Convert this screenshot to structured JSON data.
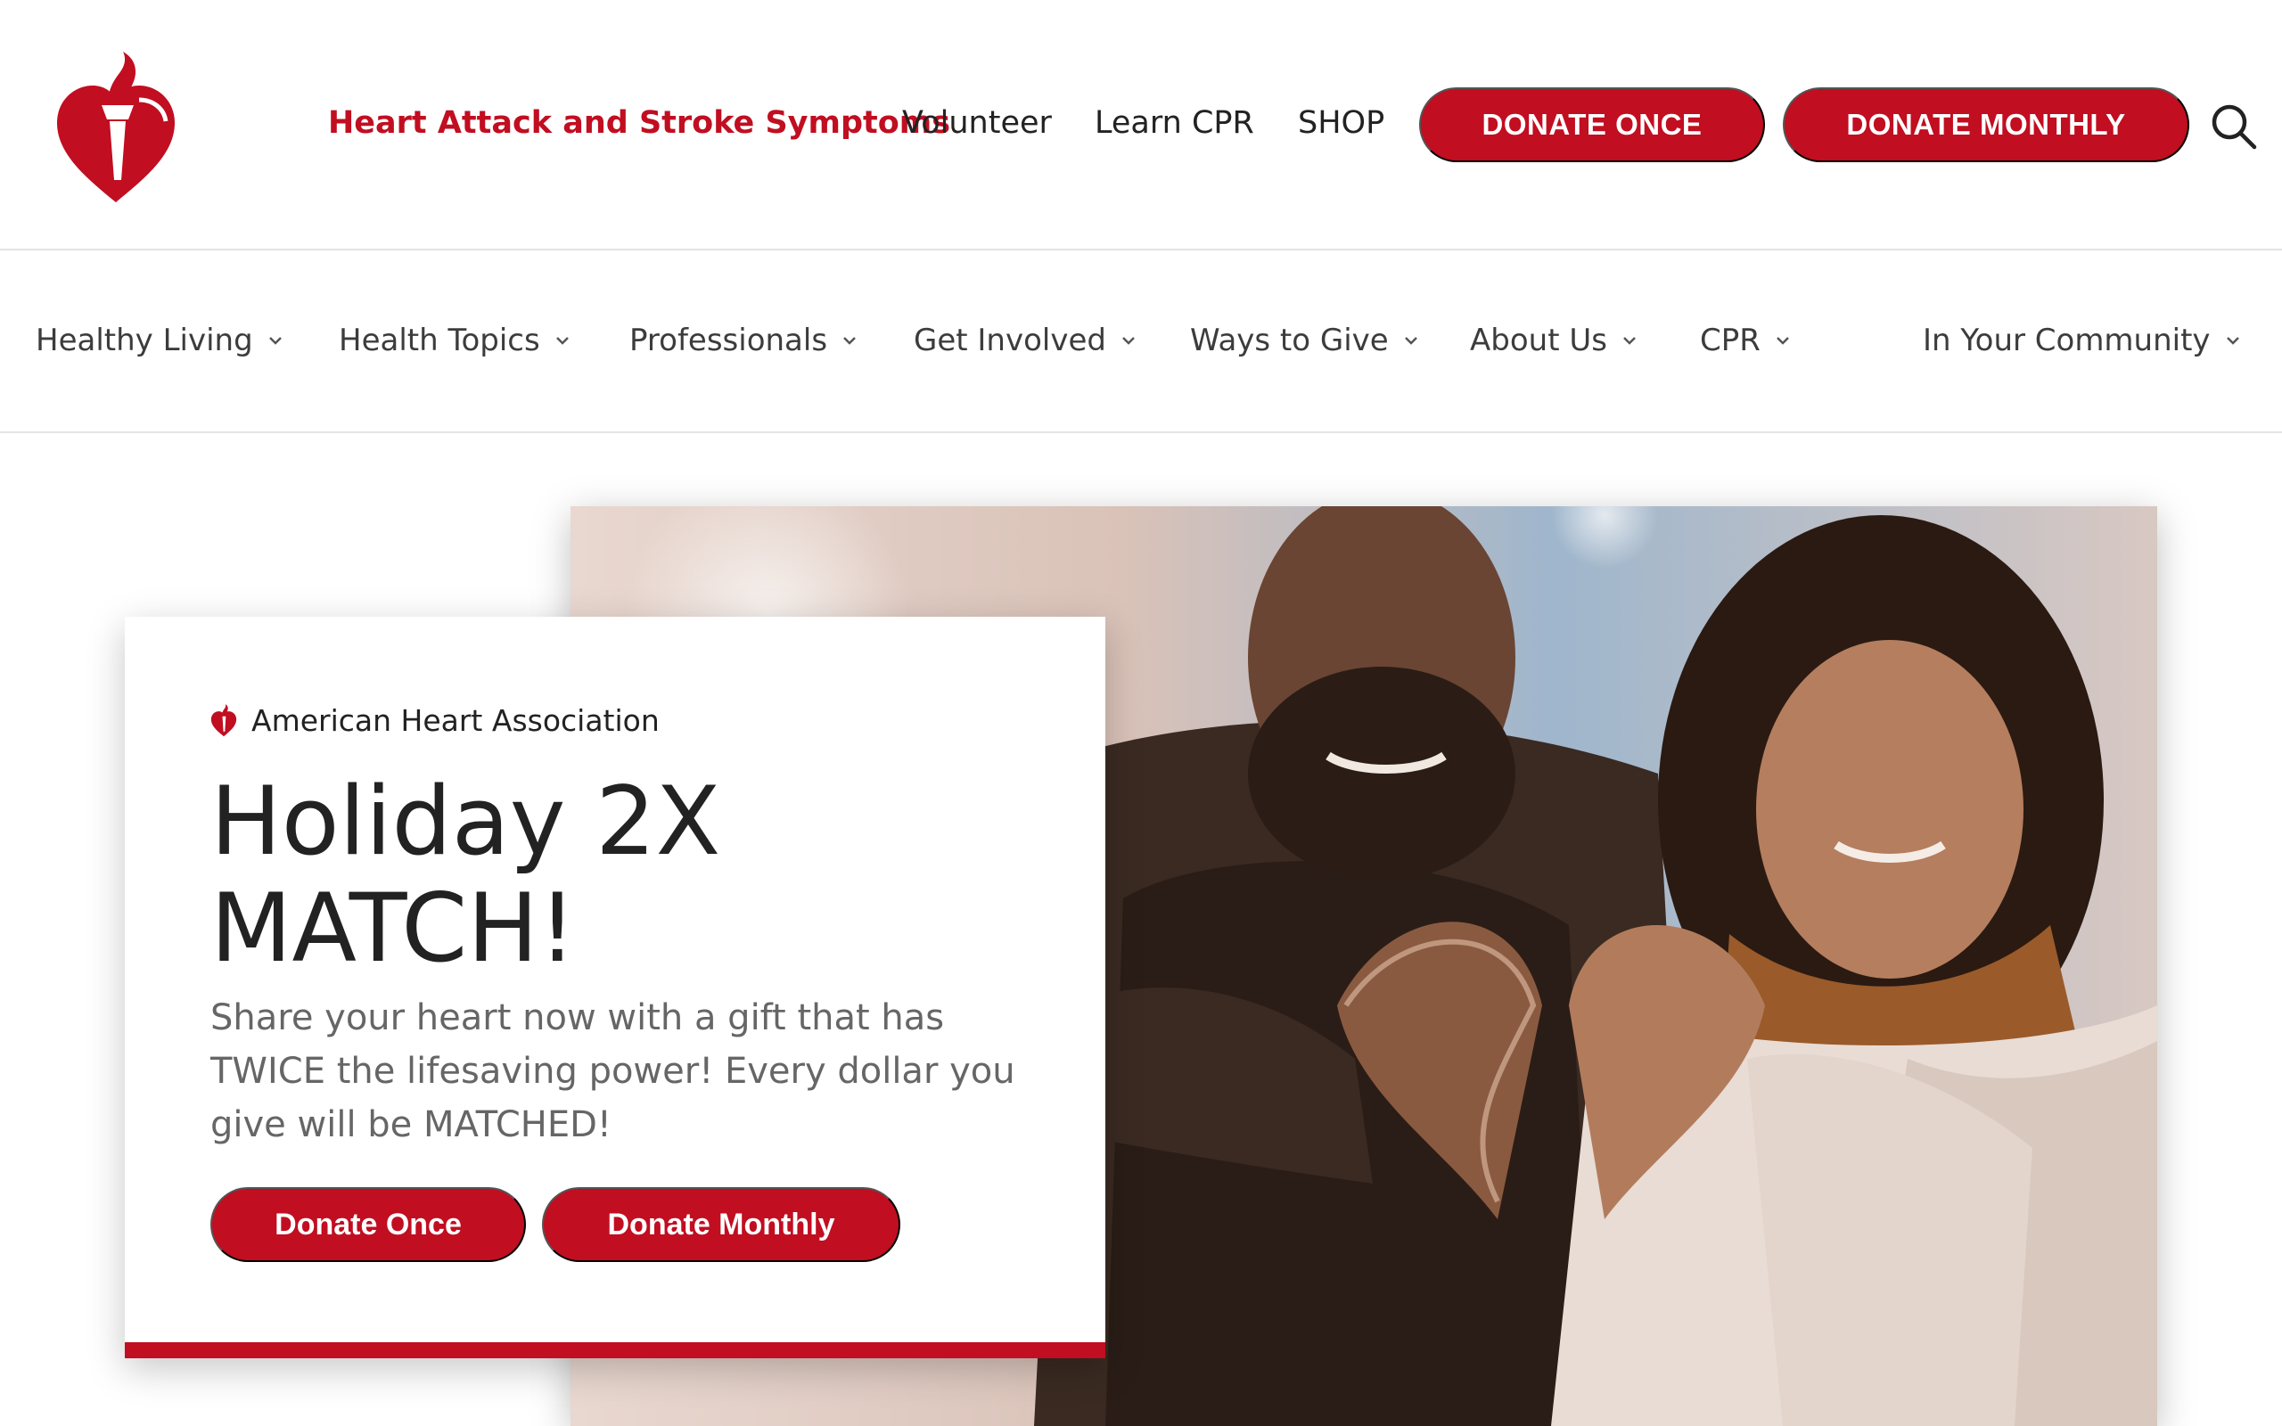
{
  "header": {
    "logo_icon": "aha-heart-torch-logo",
    "links": [
      {
        "label": "Heart Attack and Stroke Symptoms",
        "highlight": true
      },
      {
        "label": "Volunteer"
      },
      {
        "label": "Learn CPR"
      },
      {
        "label": "SHOP"
      }
    ],
    "donate_once": "DONATE ONCE",
    "donate_monthly": "DONATE MONTHLY",
    "search_icon": "search-icon"
  },
  "nav": {
    "items": [
      {
        "label": "Healthy Living"
      },
      {
        "label": "Health Topics"
      },
      {
        "label": "Professionals"
      },
      {
        "label": "Get Involved"
      },
      {
        "label": "Ways to Give"
      },
      {
        "label": "About Us"
      },
      {
        "label": "CPR"
      },
      {
        "label": "In Your Community"
      }
    ],
    "dropdown_icon": "chevron-down-icon"
  },
  "hero": {
    "brand": "American Heart Association",
    "title": "Holiday 2X MATCH!",
    "description": "Share your heart now with a gift that has TWICE the lifesaving power! Every dollar you give will be MATCHED!",
    "donate_once": "Donate Once",
    "donate_monthly": "Donate Monthly"
  },
  "colors": {
    "brand_red": "#c10e21",
    "text_dark": "#222222",
    "text_muted": "#666666",
    "divider": "#e4e4e4"
  }
}
